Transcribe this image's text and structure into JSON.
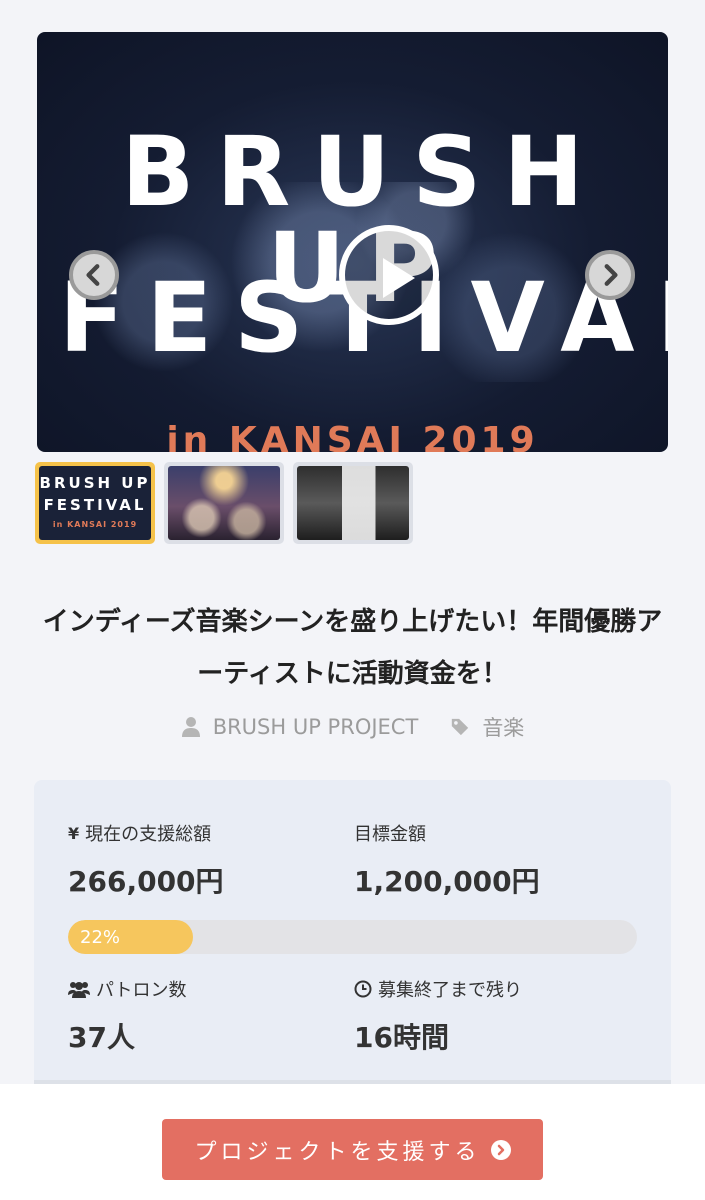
{
  "hero": {
    "line1": "BRUSH UP",
    "line2": "FESTIVAL",
    "subtitle": "in KANSAI 2019",
    "prev_icon": "chevron-left-icon",
    "next_icon": "chevron-right-icon",
    "play_icon": "play-icon"
  },
  "thumbnails": [
    {
      "line1": "BRUSH UP",
      "line2": "FESTIVAL",
      "line3": "in KANSAI 2019",
      "active": true
    },
    {
      "active": false
    },
    {
      "active": false
    }
  ],
  "project": {
    "title": "インディーズ音楽シーンを盛り上げたい！年間優勝アーティストに活動資金を！",
    "owner": "BRUSH UP PROJECT",
    "owner_icon": "user-icon",
    "category": "音楽",
    "category_icon": "tag-icon"
  },
  "stats": {
    "current_label": "現在の支援総額",
    "current_icon": "¥",
    "current_value": "266,000円",
    "goal_label": "目標金額",
    "goal_value": "1,200,000円",
    "progress_percent": 22,
    "progress_label": "22%",
    "patrons_label": "パトロン数",
    "patrons_icon": "users-icon",
    "patrons_value": "37人",
    "remaining_label": "募集終了まで残り",
    "remaining_icon": "clock-icon",
    "remaining_value": "16時間"
  },
  "cta": {
    "label": "プロジェクトを支援する",
    "icon": "chevron-circle-right-icon"
  },
  "colors": {
    "accent_orange": "#e07a58",
    "progress": "#f6c65d",
    "cta": "#e36f62",
    "active_thumb": "#f5c24a"
  }
}
